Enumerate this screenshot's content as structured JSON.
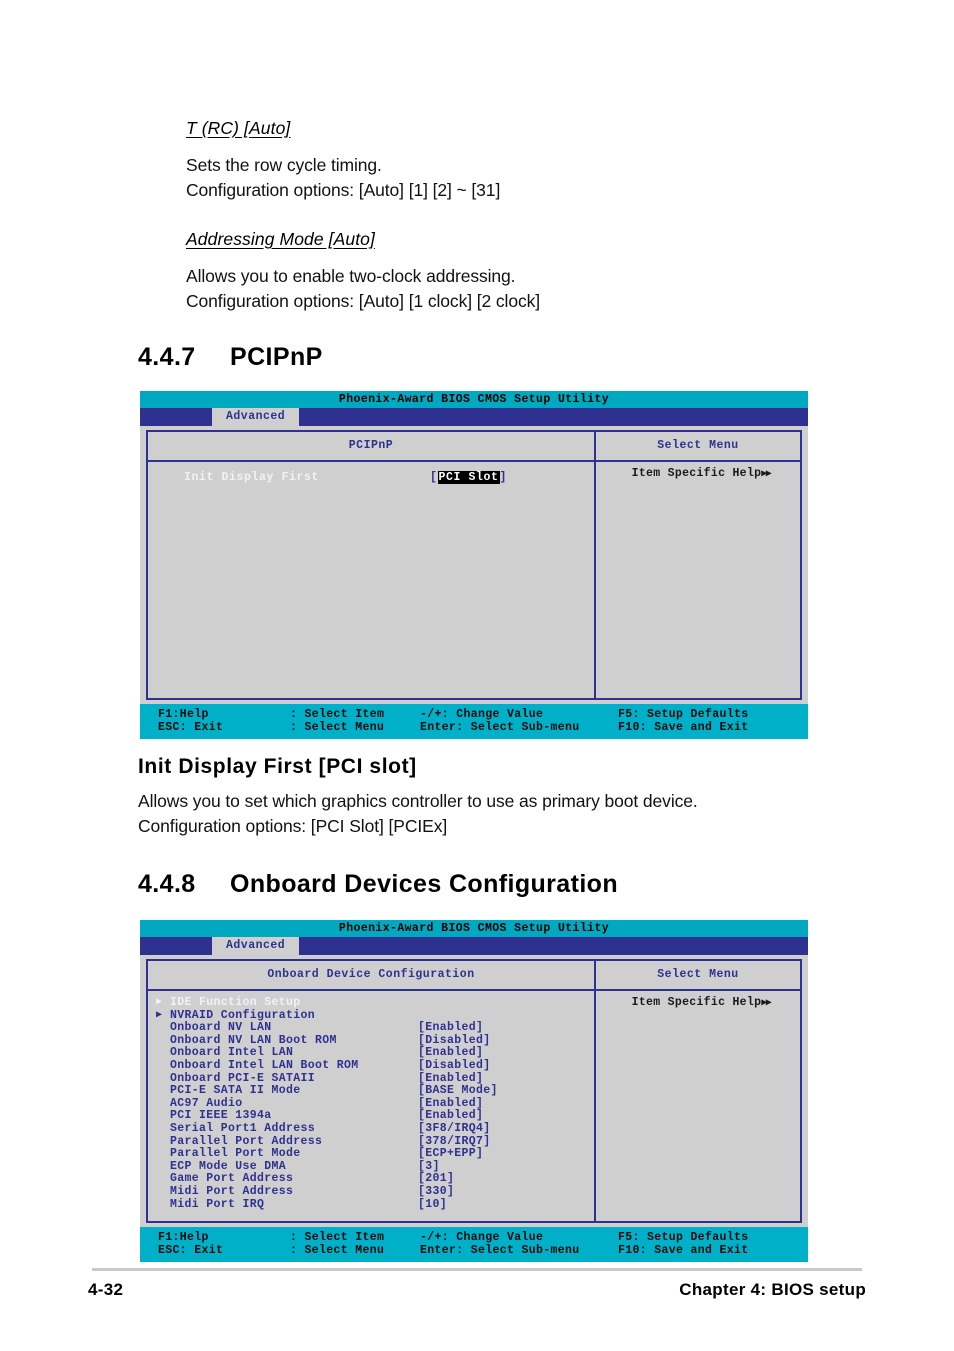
{
  "doc": {
    "page_number": "4-32",
    "chapter_label": "Chapter 4: BIOS setup"
  },
  "sections": {
    "trc": {
      "heading": "T (RC) [Auto]",
      "line1": "Sets the row cycle timing.",
      "line2": "Configuration options: [Auto] [1] [2] ~ [31]"
    },
    "addressing": {
      "heading": "Addressing Mode [Auto]",
      "line1": "Allows you to enable two-clock addressing.",
      "line2": "Configuration options: [Auto] [1 clock] [2 clock]"
    },
    "s447": {
      "number": "4.4.7",
      "title": "PCIPnP"
    },
    "init_display": {
      "heading": "Init Display First [PCI slot]",
      "line1": "Allows you to set which graphics controller to use as primary boot device.",
      "line2": "Configuration options: [PCI Slot] [PCIEx]"
    },
    "s448": {
      "number": "4.4.8",
      "title": "Onboard Devices Configuration"
    }
  },
  "bios_common": {
    "title": "Phoenix-Award BIOS CMOS Setup Utility",
    "tab": "Advanced",
    "side_header": "Select Menu",
    "help_text": "Item Specific Help",
    "help_arrows": "▶▶",
    "submenu_arrow": "▶",
    "footer": {
      "f1_help": "F1:Help",
      "esc_exit": "ESC: Exit",
      "select_item": ":  Select Item",
      "select_menu": ":  Select Menu",
      "change_value": "-/+: Change Value",
      "select_submenu": "Enter: Select Sub-menu",
      "setup_defaults": "F5: Setup Defaults",
      "save_exit": "F10: Save and Exit"
    }
  },
  "bios_pcipnp": {
    "main_header": "PCIPnP",
    "items": [
      {
        "label": "Init Display First",
        "value": "PCI Slot",
        "selected": true,
        "value_highlighted": true
      }
    ]
  },
  "bios_onboard": {
    "main_header": "Onboard Device Configuration",
    "items": [
      {
        "label": "IDE Function Setup",
        "value": "",
        "submenu": true,
        "selected": true
      },
      {
        "label": "NVRAID Configuration",
        "value": "",
        "submenu": true,
        "selected": false
      },
      {
        "label": "Onboard NV LAN",
        "value": "[Enabled]",
        "submenu": false,
        "selected": false
      },
      {
        "label": "Onboard NV LAN Boot ROM",
        "value": "[Disabled]",
        "submenu": false,
        "selected": false
      },
      {
        "label": "Onboard Intel LAN",
        "value": "[Enabled]",
        "submenu": false,
        "selected": false
      },
      {
        "label": "Onboard Intel LAN Boot ROM",
        "value": "[Disabled]",
        "submenu": false,
        "selected": false
      },
      {
        "label": "Onboard PCI-E SATAII",
        "value": "[Enabled]",
        "submenu": false,
        "selected": false
      },
      {
        "label": "PCI-E SATA II Mode",
        "value": "[BASE Mode]",
        "submenu": false,
        "selected": false
      },
      {
        "label": "AC97 Audio",
        "value": "[Enabled]",
        "submenu": false,
        "selected": false
      },
      {
        "label": "PCI IEEE 1394a",
        "value": "[Enabled]",
        "submenu": false,
        "selected": false
      },
      {
        "label": "Serial Port1 Address",
        "value": "[3F8/IRQ4]",
        "submenu": false,
        "selected": false
      },
      {
        "label": "Parallel Port Address",
        "value": "[378/IRQ7]",
        "submenu": false,
        "selected": false
      },
      {
        "label": "Parallel Port Mode",
        "value": "[ECP+EPP]",
        "submenu": false,
        "selected": false
      },
      {
        "label": "ECP Mode Use DMA",
        "value": "[3]",
        "submenu": false,
        "selected": false
      },
      {
        "label": "Game Port Address",
        "value": "[201]",
        "submenu": false,
        "selected": false
      },
      {
        "label": "Midi Port Address",
        "value": "[330]",
        "submenu": false,
        "selected": false
      },
      {
        "label": "Midi Port IRQ",
        "value": "[10]",
        "submenu": false,
        "selected": false
      }
    ]
  },
  "colors": {
    "titlebar_cyan": "#00a8c0",
    "footer_cyan": "#00b0c8",
    "tab_indigo": "#2e3190",
    "panel_gray": "#cfcfcf",
    "selected_text": "#f2f2f2"
  }
}
